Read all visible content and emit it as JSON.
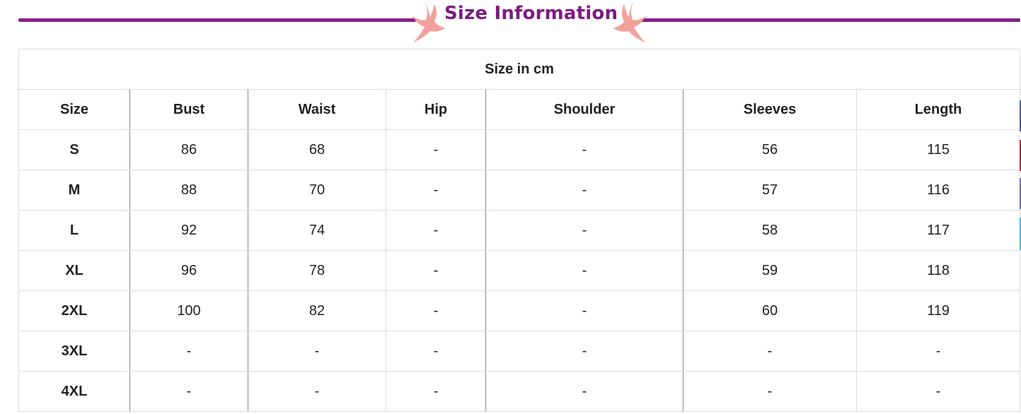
{
  "banner": {
    "title": "Size Information",
    "line_color": "#8b1e8f",
    "bird_color": "#f2a19a"
  },
  "table": {
    "caption": "Size in cm",
    "headers": [
      "Size",
      "Bust",
      "Waist",
      "Hip",
      "Shoulder",
      "Sleeves",
      "Length"
    ],
    "rows": [
      [
        "S",
        "86",
        "68",
        "-",
        "-",
        "56",
        "115"
      ],
      [
        "M",
        "88",
        "70",
        "-",
        "-",
        "57",
        "116"
      ],
      [
        "L",
        "92",
        "74",
        "-",
        "-",
        "58",
        "117"
      ],
      [
        "XL",
        "96",
        "78",
        "-",
        "-",
        "59",
        "118"
      ],
      [
        "2XL",
        "100",
        "82",
        "-",
        "-",
        "60",
        "119"
      ],
      [
        "3XL",
        "-",
        "-",
        "-",
        "-",
        "-",
        "-"
      ],
      [
        "4XL",
        "-",
        "-",
        "-",
        "-",
        "-",
        "-"
      ]
    ]
  }
}
